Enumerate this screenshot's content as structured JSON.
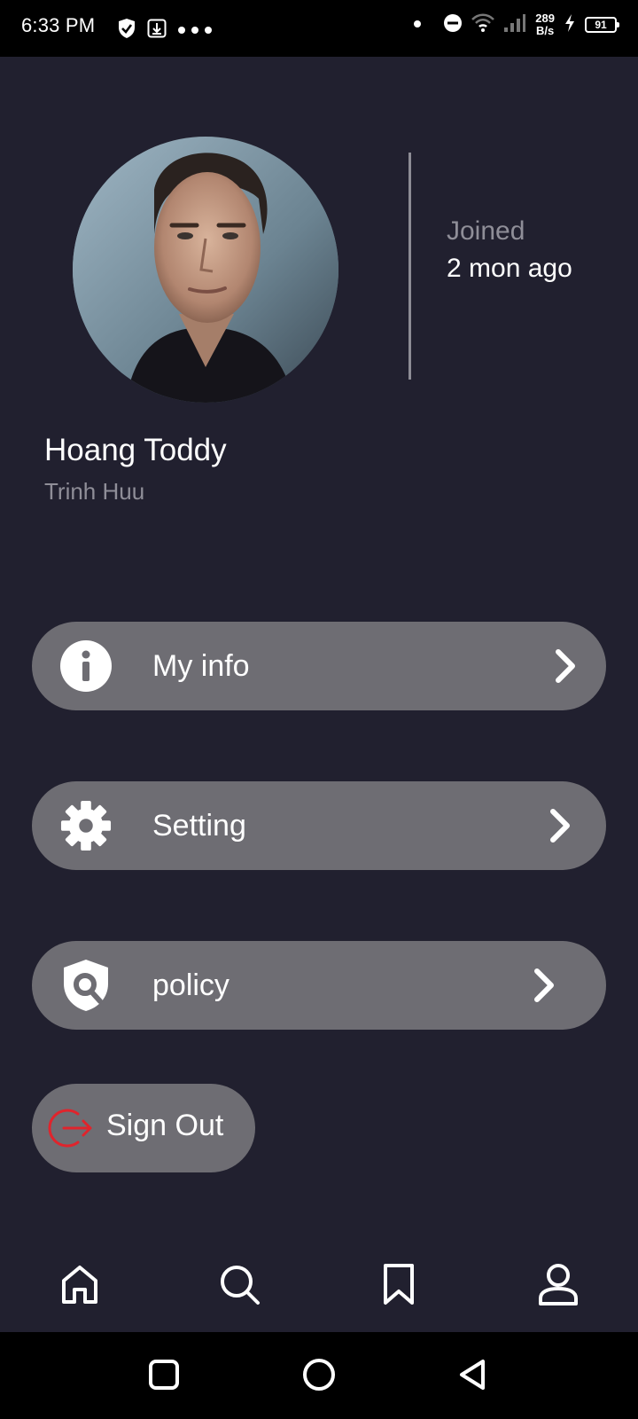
{
  "status_bar": {
    "time": "6:33 PM",
    "net_speed_value": "289",
    "net_speed_unit": "B/s",
    "battery": "91",
    "icons": [
      "shield-icon",
      "usb-download-icon",
      "more-dots-icon",
      "dot-icon",
      "do-not-disturb-icon",
      "wifi-icon",
      "signal-icon",
      "charging-icon"
    ]
  },
  "profile": {
    "name": "Hoang Toddy",
    "subname": "Trinh Huu",
    "joined_label": "Joined",
    "joined_value": "2 mon ago"
  },
  "menu": [
    {
      "label": "My info",
      "icon": "info-icon"
    },
    {
      "label": "Setting",
      "icon": "gear-icon"
    },
    {
      "label": "policy",
      "icon": "shield-search-icon"
    }
  ],
  "sign_out": {
    "label": "Sign Out",
    "icon": "sign-out-icon",
    "icon_color": "#e0242c"
  },
  "bottom_nav": [
    "home-icon",
    "search-icon",
    "bookmark-icon",
    "profile-icon"
  ],
  "system_nav": [
    "recents-icon",
    "home-circle-icon",
    "back-icon"
  ],
  "colors": {
    "background": "#21202f",
    "button": "#6e6d73",
    "muted_text": "#8f8e98",
    "accent_red": "#e0242c"
  }
}
